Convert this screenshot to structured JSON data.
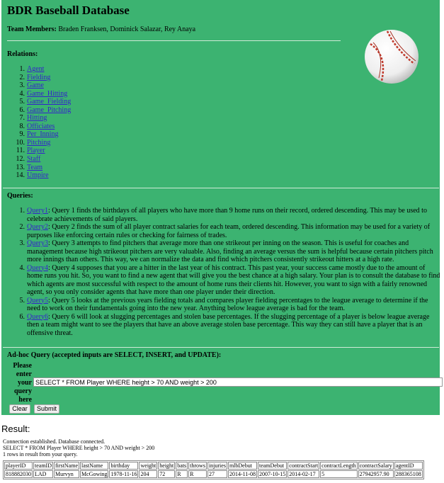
{
  "header": {
    "title": "BDR Baseball Database",
    "team_label": "Team Members:",
    "team_members": "Braden Franksen, Dominick Salazar, Rey Anaya"
  },
  "relations": {
    "label": "Relations:",
    "items": [
      "Agent",
      "Fielding",
      "Game",
      "Game_Hitting",
      "Game_Fielding",
      "Game_Pitching",
      "Hitting",
      "Officiates",
      "Per_Inning",
      "Pitching",
      "Player",
      "Staff",
      "Team",
      "Umpire"
    ]
  },
  "queries": {
    "label": "Queries:",
    "items": [
      {
        "link": "Query1",
        "text": ": Query 1 finds the birthdays of all players who have more than 9 home runs on their record, ordered descending. This may be used to celebrate achievements of said players."
      },
      {
        "link": "Query2",
        "text": ": Query 2 finds the sum of all player contract salaries for each team, ordered descending. This information may be used for a variety of purposes like enforcing certain rules or checking for fairness of trades."
      },
      {
        "link": "Query3",
        "text": ": Query 3 attempts to find pitchers that average more than one strikeout per inning on the season. This is useful for coaches and management because high strikeout pitchers are very valuable. Also, finding an average versus the sum is helpful because certain pitchers pitch more innings than others. This way, we can normalize the data and find which pitchers consistently strikeout hitters at a high rate."
      },
      {
        "link": "Query4",
        "text": ": Query 4 supposes that you are a hitter in the last year of his contract. This past year, your success came mostly due to the amount of home runs you hit. So, you want to find a new agent that will give you the best chance at a high salary. Your plan is to consult the database to find which agents are most successful with respect to the amount of home runs their clients hit. However, you want to sign with a fairly renowned agent, so you only consider agents that have more than one player under their direction."
      },
      {
        "link": "Query5",
        "text": ": Query 5 looks at the previous years fielding totals and compares player fielding percentages to the league average to determine if the need to work on their fundamentals going into the new year. Anything below league average is bad for the team."
      },
      {
        "link": "Query6",
        "text": ": Query 6 will look at slugging percentages and stolen base percentages. If the slugging percentage of a player is below league average then a team might want to see the players that have an above average stolen base percentage. This way they can still have a player that is an offensive threat."
      }
    ]
  },
  "adhoc": {
    "label": "Ad-hoc Query (accepted inputs are SELECT, INSERT, and UPDATE):",
    "prompt": "Please enter your query here",
    "value": "SELECT * FROM Player WHERE height > 70 AND weight > 200",
    "clear_label": "Clear",
    "submit_label": "Submit"
  },
  "result": {
    "heading": "Result:",
    "status_lines": [
      "Connection established. Database connected.",
      "SELECT * FROM Player WHERE height > 70 AND weight > 200",
      "1 rows in result from your query."
    ],
    "columns": [
      "playerID",
      "teamID",
      "firstName",
      "lastName",
      "birthday",
      "weight",
      "height",
      "bats",
      "throws",
      "injuries",
      "mlbDebut",
      "teamDebut",
      "contractStart",
      "contractLength",
      "contractSalary",
      "agentID"
    ],
    "rows": [
      [
        "818882030",
        "LAD",
        "Murvyn",
        "McGowing",
        "1978-11-16",
        "204",
        "72",
        "R",
        "R",
        "27",
        "2014-11-08",
        "2007-10-15",
        "2014-02-17",
        "5",
        "27942957.90",
        "288365108"
      ]
    ]
  },
  "colors": {
    "panel": "#3cb371",
    "link": "#3322cc"
  }
}
